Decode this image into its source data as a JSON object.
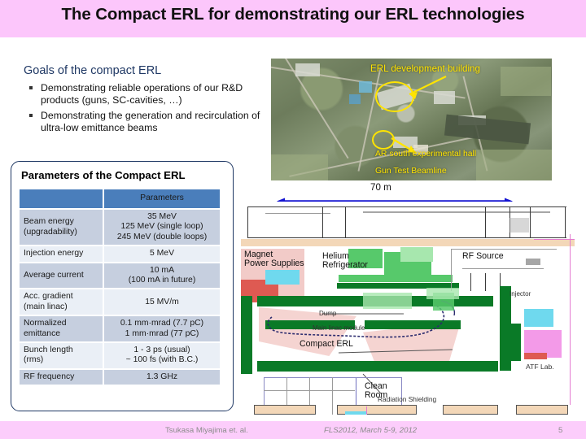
{
  "slide": {
    "title": "The Compact ERL for demonstrating our ERL technologies"
  },
  "goals": {
    "heading": "Goals of the compact ERL",
    "items": [
      "Demonstrating reliable operations of our R&D products (guns, SC-cavities, …)",
      "Demonstrating the generation and recirculation of ultra-low emittance beams"
    ]
  },
  "parameters": {
    "title": "Parameters of the Compact ERL",
    "header": {
      "key": "",
      "value": "Parameters"
    },
    "rows": [
      {
        "key": "Beam energy\n(upgradability)",
        "value": "35 MeV\n125 MeV (single loop)\n245 MeV (double loops)"
      },
      {
        "key": "Injection energy",
        "value": "5 MeV"
      },
      {
        "key": "Average current",
        "value": "10  mA\n(100 mA in future)"
      },
      {
        "key": "Acc. gradient\n(main linac)",
        "value": "15 MV/m"
      },
      {
        "key": "Normalized\nemittance",
        "value": "0.1 mm·mrad (7.7 pC)\n1 mm·mrad (77 pC)"
      },
      {
        "key": "Bunch length\n(rms)",
        "value": "1 - 3 ps (usual)\n~ 100 fs (with B.C.)"
      },
      {
        "key": "RF frequency",
        "value": "1.3 GHz"
      }
    ]
  },
  "photo": {
    "labels": {
      "erl_building": "ERL development building",
      "ar_south": "AR south experimental hall",
      "gun_test": "Gun Test Beamline"
    }
  },
  "floorplan": {
    "dimension": "70 m",
    "labels": {
      "magnet_power": "Magnet\nPower Supplies",
      "helium": "Helium\nRefrigerator",
      "rf_source": "RF Source",
      "injector": "Injector",
      "dump": "Dump",
      "main_linac": "Main linac module",
      "compact_erl": "Compact ERL",
      "clean_room": "Clean\nRoom",
      "radiation_shielding": "Radiation Shielding",
      "atf_lab": "ATF Lab."
    }
  },
  "footer": {
    "author": "Tsukasa Miyajima et. al.",
    "conference": "FLS2012, March 5-9, 2012",
    "page": "5"
  },
  "colors": {
    "title_band": "#fcc6fb",
    "footer_band": "#fccdfb",
    "heading_blue": "#1f3864",
    "table_header": "#4a7ebb",
    "row_dark": "#c6cfdf",
    "row_light": "#eaeff6",
    "annotation_yellow": "#ffe400",
    "dimension_blue": "#1414d2"
  }
}
